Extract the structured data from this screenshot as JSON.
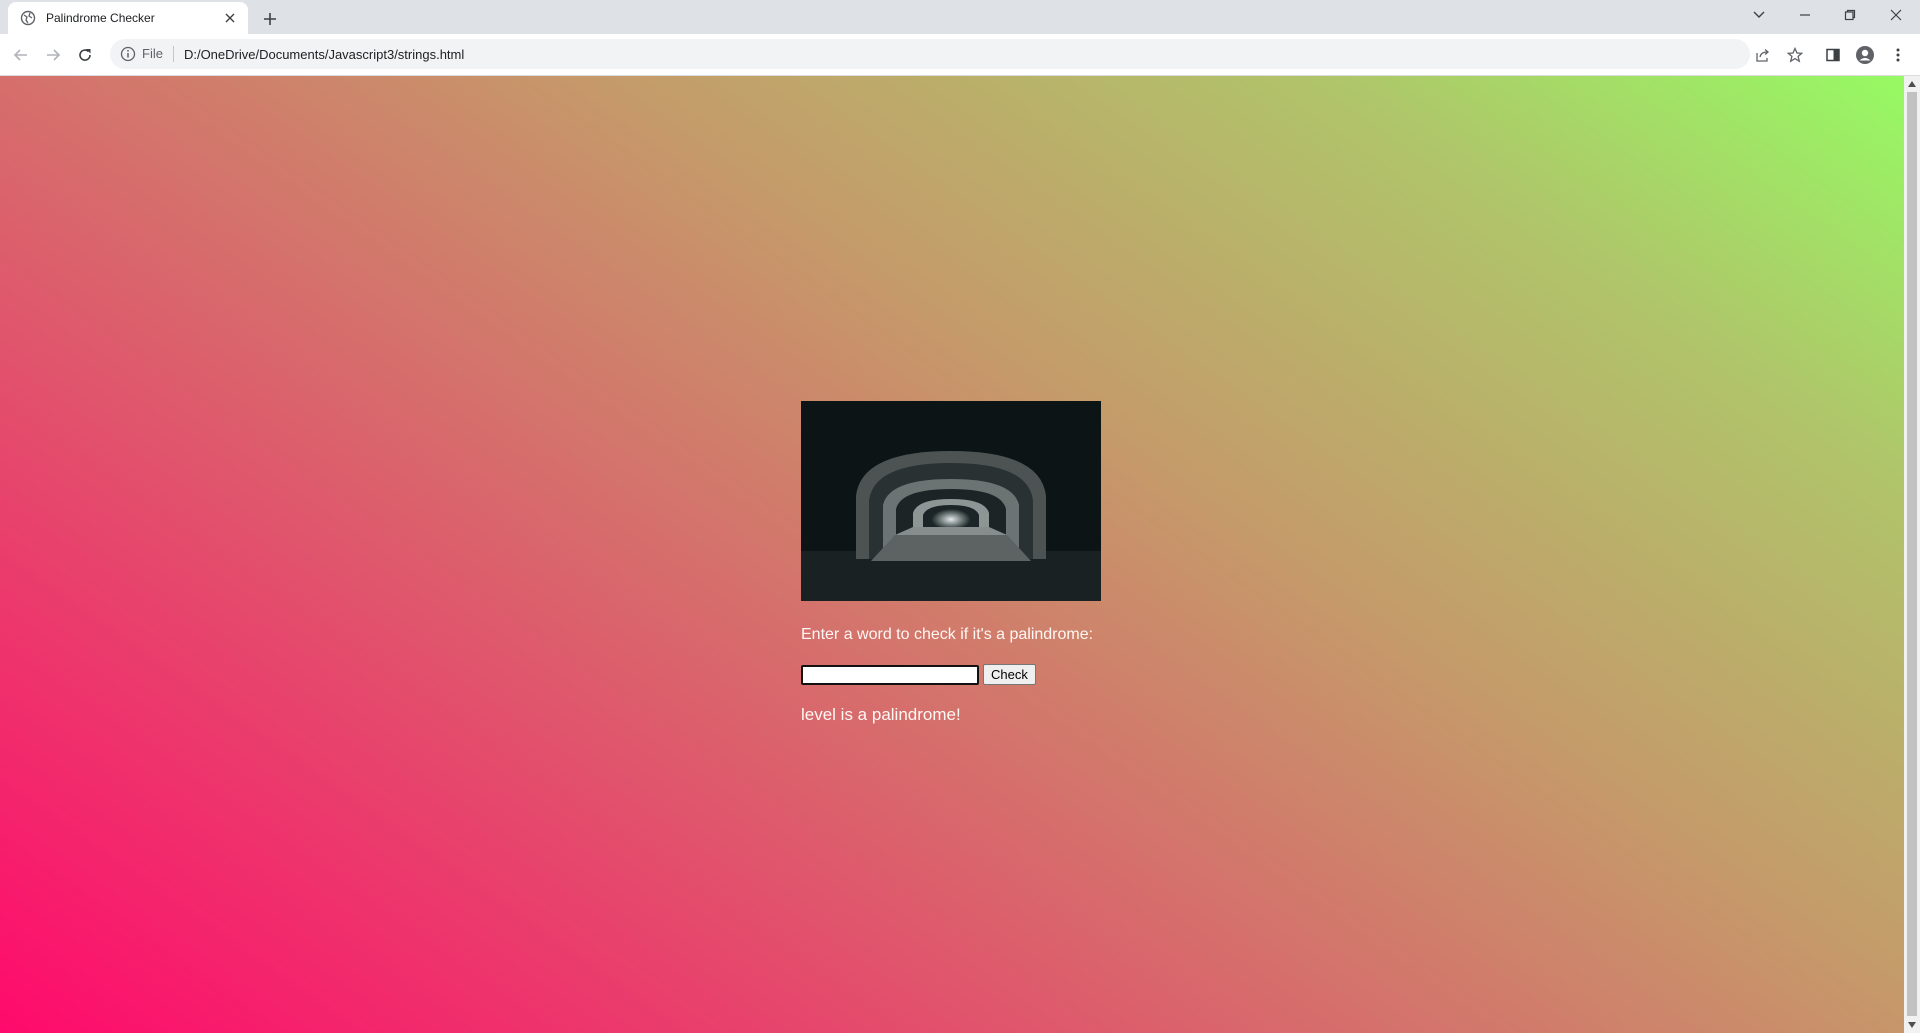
{
  "browser": {
    "tab_title": "Palindrome Checker",
    "url_scheme": "File",
    "url": "D:/OneDrive/Documents/Javascript3/strings.html",
    "icons": [
      "globe-icon",
      "close-icon",
      "plus-icon",
      "back-icon",
      "forward-icon",
      "reload-icon",
      "info-icon",
      "share-icon",
      "star-icon",
      "sidepanel-icon",
      "profile-icon",
      "menu-icon",
      "tab-search-icon",
      "minimize-icon",
      "restore-icon",
      "window-close-icon"
    ]
  },
  "page": {
    "prompt": "Enter a word to check if it's a palindrome:",
    "input_value": "",
    "check_label": "Check",
    "result": "level is a palindrome!",
    "colors": {
      "gradient_start": "#ff0a6c",
      "gradient_mid": "#c59a6a",
      "gradient_end": "#96fa63",
      "text": "#fff7f4"
    }
  }
}
